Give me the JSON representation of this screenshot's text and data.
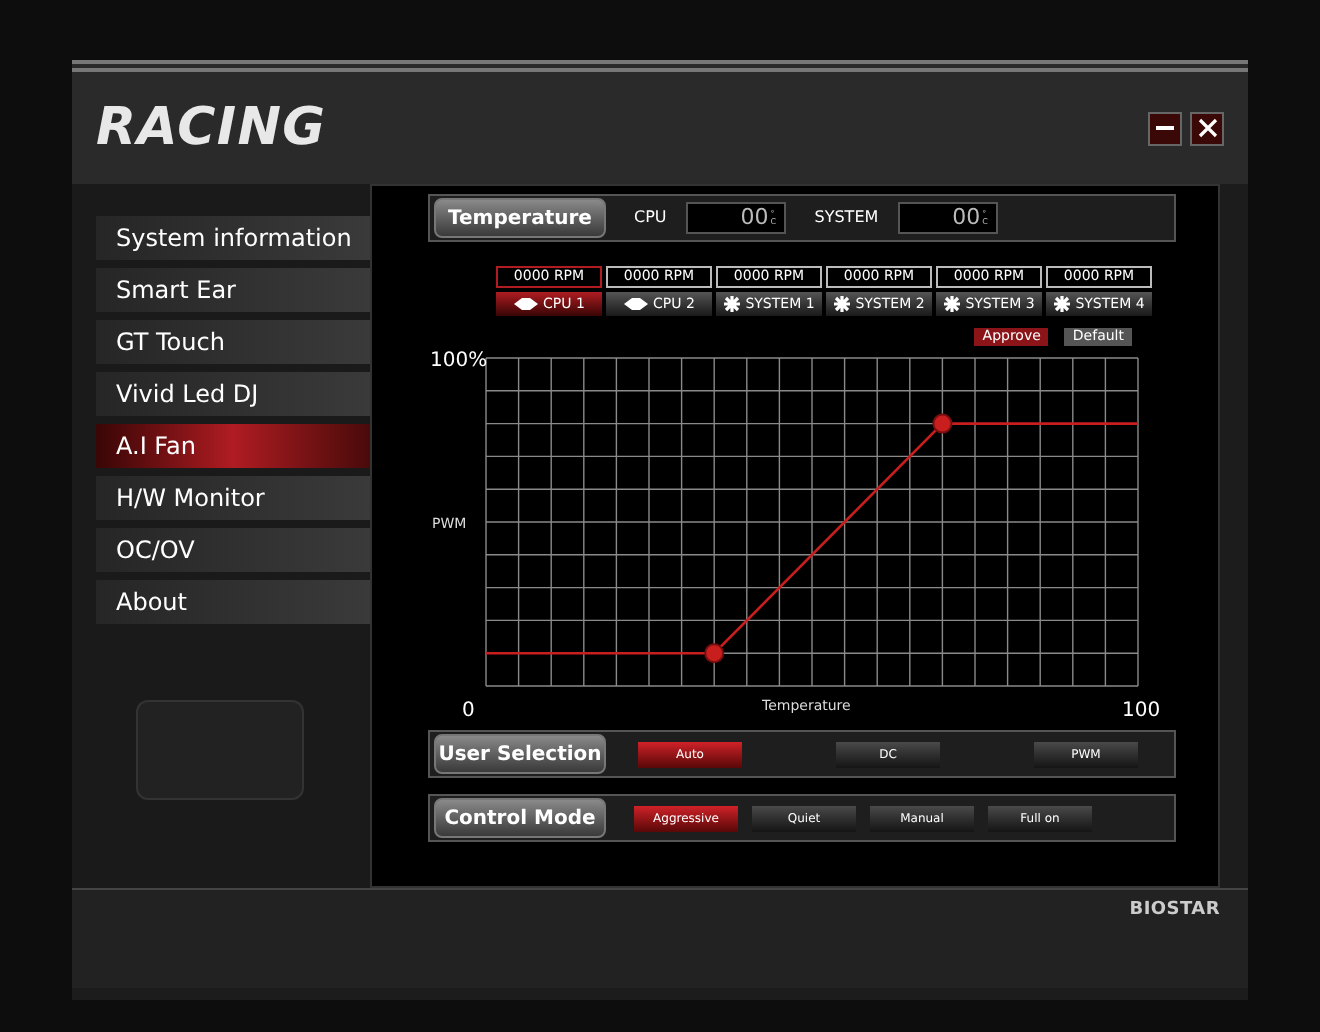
{
  "app": {
    "logo": "RACING",
    "brand": "BIOSTAR"
  },
  "sidebar": {
    "items": [
      {
        "label": "System information",
        "selected": false
      },
      {
        "label": "Smart Ear",
        "selected": false
      },
      {
        "label": "GT Touch",
        "selected": false
      },
      {
        "label": "Vivid Led DJ",
        "selected": false
      },
      {
        "label": "A.I Fan",
        "selected": true
      },
      {
        "label": "H/W Monitor",
        "selected": false
      },
      {
        "label": "OC/OV",
        "selected": false
      },
      {
        "label": "About",
        "selected": false
      }
    ]
  },
  "temperature": {
    "label": "Temperature",
    "sensors": [
      {
        "name": "CPU",
        "reading": "00",
        "unit": "°C"
      },
      {
        "name": "SYSTEM",
        "reading": "00",
        "unit": "°C"
      }
    ]
  },
  "fans": [
    {
      "rpm": "0000 RPM",
      "label": "CPU 1",
      "kind": "cpu",
      "selected": true
    },
    {
      "rpm": "0000 RPM",
      "label": "CPU 2",
      "kind": "cpu",
      "selected": false
    },
    {
      "rpm": "0000 RPM",
      "label": "SYSTEM 1",
      "kind": "system",
      "selected": false
    },
    {
      "rpm": "0000 RPM",
      "label": "SYSTEM 2",
      "kind": "system",
      "selected": false
    },
    {
      "rpm": "0000 RPM",
      "label": "SYSTEM 3",
      "kind": "system",
      "selected": false
    },
    {
      "rpm": "0000 RPM",
      "label": "SYSTEM 4",
      "kind": "system",
      "selected": false
    }
  ],
  "curve_actions": [
    {
      "label": "Approve",
      "selected": true
    },
    {
      "label": "Default",
      "selected": false
    }
  ],
  "curve": {
    "y_max_label": "100%",
    "y_label": "PWM",
    "x_min_label": "0",
    "x_label": "Temperature",
    "x_max_label": "100"
  },
  "option_groups": [
    {
      "label": "User Selection",
      "options": [
        {
          "label": "Auto",
          "selected": true
        },
        {
          "label": "DC",
          "selected": false
        },
        {
          "label": "PWM",
          "selected": false
        }
      ]
    },
    {
      "label": "Control Mode",
      "options": [
        {
          "label": "Aggressive",
          "selected": true
        },
        {
          "label": "Quiet",
          "selected": false
        },
        {
          "label": "Manual",
          "selected": false
        },
        {
          "label": "Full on",
          "selected": false
        }
      ]
    }
  ]
}
